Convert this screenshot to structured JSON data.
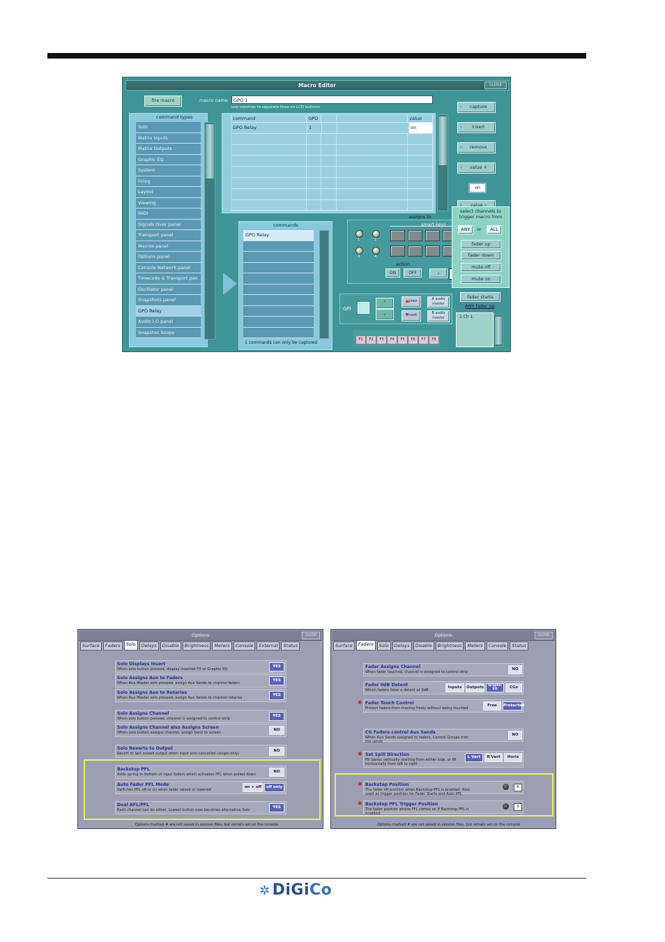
{
  "macro_editor": {
    "title": "Macro Editor",
    "close": "CLOSE",
    "fire_macro": "fire macro",
    "macro_name_label": "macro name",
    "macro_name_value": "GPO 1",
    "hint": "use commas to separate lines on LCD buttons",
    "command_types_label": "command types",
    "command_types": [
      "Solo",
      "Matrix Inputs",
      "Matrix Outputs",
      "Graphic EQ",
      "System",
      "Firing",
      "Layout",
      "Viewing",
      "MIDI",
      "Signals Over panel",
      "Transport panel",
      "Macros panel",
      "Options panel",
      "Console Network panel",
      "Timecode & Transport pan",
      "Oscillator panel",
      "Snapshots panel",
      "GPO Relay",
      "Audio I-O panel",
      "Snapshot Scope"
    ],
    "selected_command_type": "GPO Relay",
    "grid_headers": {
      "command": "command",
      "gpo": "GPO",
      "value": "value"
    },
    "grid_row": {
      "command": "GPO Relay",
      "gpo": "1",
      "value": "on"
    },
    "commands_label": "commands",
    "commands": [
      "GPO Relay"
    ],
    "commands_note": "1 commands can only be captured",
    "side_buttons": {
      "capture": "capture",
      "insert": "insert",
      "remove": "remove",
      "value_up": "value",
      "value_display": "on",
      "value_down": "value"
    },
    "assigns_to": "assigns to",
    "smart_keys": "smart keys",
    "led_numbers": [
      "1",
      "2",
      "3",
      "4"
    ],
    "action_label": "action",
    "on": "ON",
    "off": "OFF",
    "gpi": "GPI",
    "prev": "prev",
    "next": "next",
    "a_audio_master": "A audio master",
    "b_audio_master": "B audio master",
    "f_keys": [
      "F1",
      "F2",
      "F3",
      "F4",
      "F5",
      "F6",
      "F7",
      "F8"
    ],
    "popup": {
      "title": "select channels to trigger macro from",
      "any": "ANY",
      "or": "or",
      "all": "ALL",
      "fader_up": "fader up",
      "fader_down": "fader down",
      "mute_off": "mute off",
      "mute_on": "mute on"
    },
    "fader_starts": "fader starts",
    "any_fader_up": "ANY fader up",
    "ch_list": [
      "1 Ch 1"
    ]
  },
  "options_solo": {
    "title": "Options",
    "close": "CLOSE",
    "tabs": [
      "Surface",
      "Faders",
      "Solo",
      "Delays",
      "Disable",
      "Brightness",
      "Meters",
      "Console",
      "External",
      "Status"
    ],
    "active_tab": "Solo",
    "rows": [
      {
        "title": "Solo Displays Insert",
        "desc": "When solo button pressed, display inserted FX or Graphic EQ",
        "btn": "YES"
      },
      {
        "title": "Solo Assigns Aux to Faders",
        "desc": "When Aux Master solo pressed, assign Aux Sends to channel faders",
        "btn": "YES"
      },
      {
        "title": "Solo Assigns Aux to Rotaries",
        "desc": "When Aux Master solo pressed, assign Aux Sends to channel rotaries",
        "btn": "YES"
      },
      {
        "title": "Solo Assigns Channel",
        "desc": "When solo button pressed, channel is assigned to control strip",
        "btn": "YES"
      },
      {
        "title": "Solo Assigns Channel also Assigns Screen",
        "desc": "When solo button assigns channel, assign bank to screen",
        "btn": "NO"
      },
      {
        "title": "Solo Reverts to Output",
        "desc": "Revert to last soloed output when input solo cancelled (single only)",
        "btn": "NO"
      },
      {
        "title": "Backstop PFL",
        "desc": "Adds spring to bottom of input faders which activates PFL when pulled down",
        "btn": "NO"
      },
      {
        "title": "Auto Fader PFL Mode",
        "desc": "Switches PFL off or on when fader raised or lowered",
        "btn": "on + off",
        "btn2": "off only"
      },
      {
        "title": "Dual AFL/PFL",
        "desc": "Each channel can do either. Lowest button now becomes alternative Solo",
        "btn": "YES"
      }
    ],
    "footer": "Options marked # are not saved in session files, but remain set on the console"
  },
  "options_faders": {
    "title": "Options",
    "close": "CLOSE",
    "tabs": [
      "Surface",
      "Faders",
      "Solo",
      "Delays",
      "Disable",
      "Brightness",
      "Meters",
      "Console",
      "Status"
    ],
    "active_tab": "Faders",
    "rows": [
      {
        "title": "Fader Assigns Channel",
        "desc": "When fader touched, channel is assigned to control strip",
        "btns": [
          "NO"
        ]
      },
      {
        "title": "Fader 0dB Detent",
        "desc": "Which faders have a detent at 0dB",
        "btns": [
          "Inputs",
          "Outputs",
          "Graphic EQ",
          "CGs"
        ]
      },
      {
        "title": "Fader Touch Control",
        "desc": "Protect faders from moving freely without being touched",
        "btns": [
          "Free",
          "Protected"
        ]
      },
      {
        "title": "CG Faders control Aux Sends",
        "desc": "When Aux Sends assigned to faders, Control Groups trim the sends",
        "btns": [
          "NO"
        ]
      },
      {
        "title": "Set Spill Direction",
        "desc": "Fill banks vertically starting from either side, or fill horizontally from left to right",
        "btns": [
          "L Vert",
          "R Vert",
          "Horiz"
        ]
      },
      {
        "title": "Backstop Position",
        "desc": "The fader off position when Backstop PFL is enabled. Also used as trigger position for Fader Starts and Auto PFL",
        "value": "6"
      },
      {
        "title": "Backstop PFL Trigger Position",
        "desc": "The fader position where PFL comes on if Backstop PFL is enabled.",
        "value": "3"
      }
    ],
    "footer": "Options marked # are not saved in session files, but remain set on the console"
  },
  "logo": {
    "text_di": "DiGi",
    "text_co": "Co"
  }
}
